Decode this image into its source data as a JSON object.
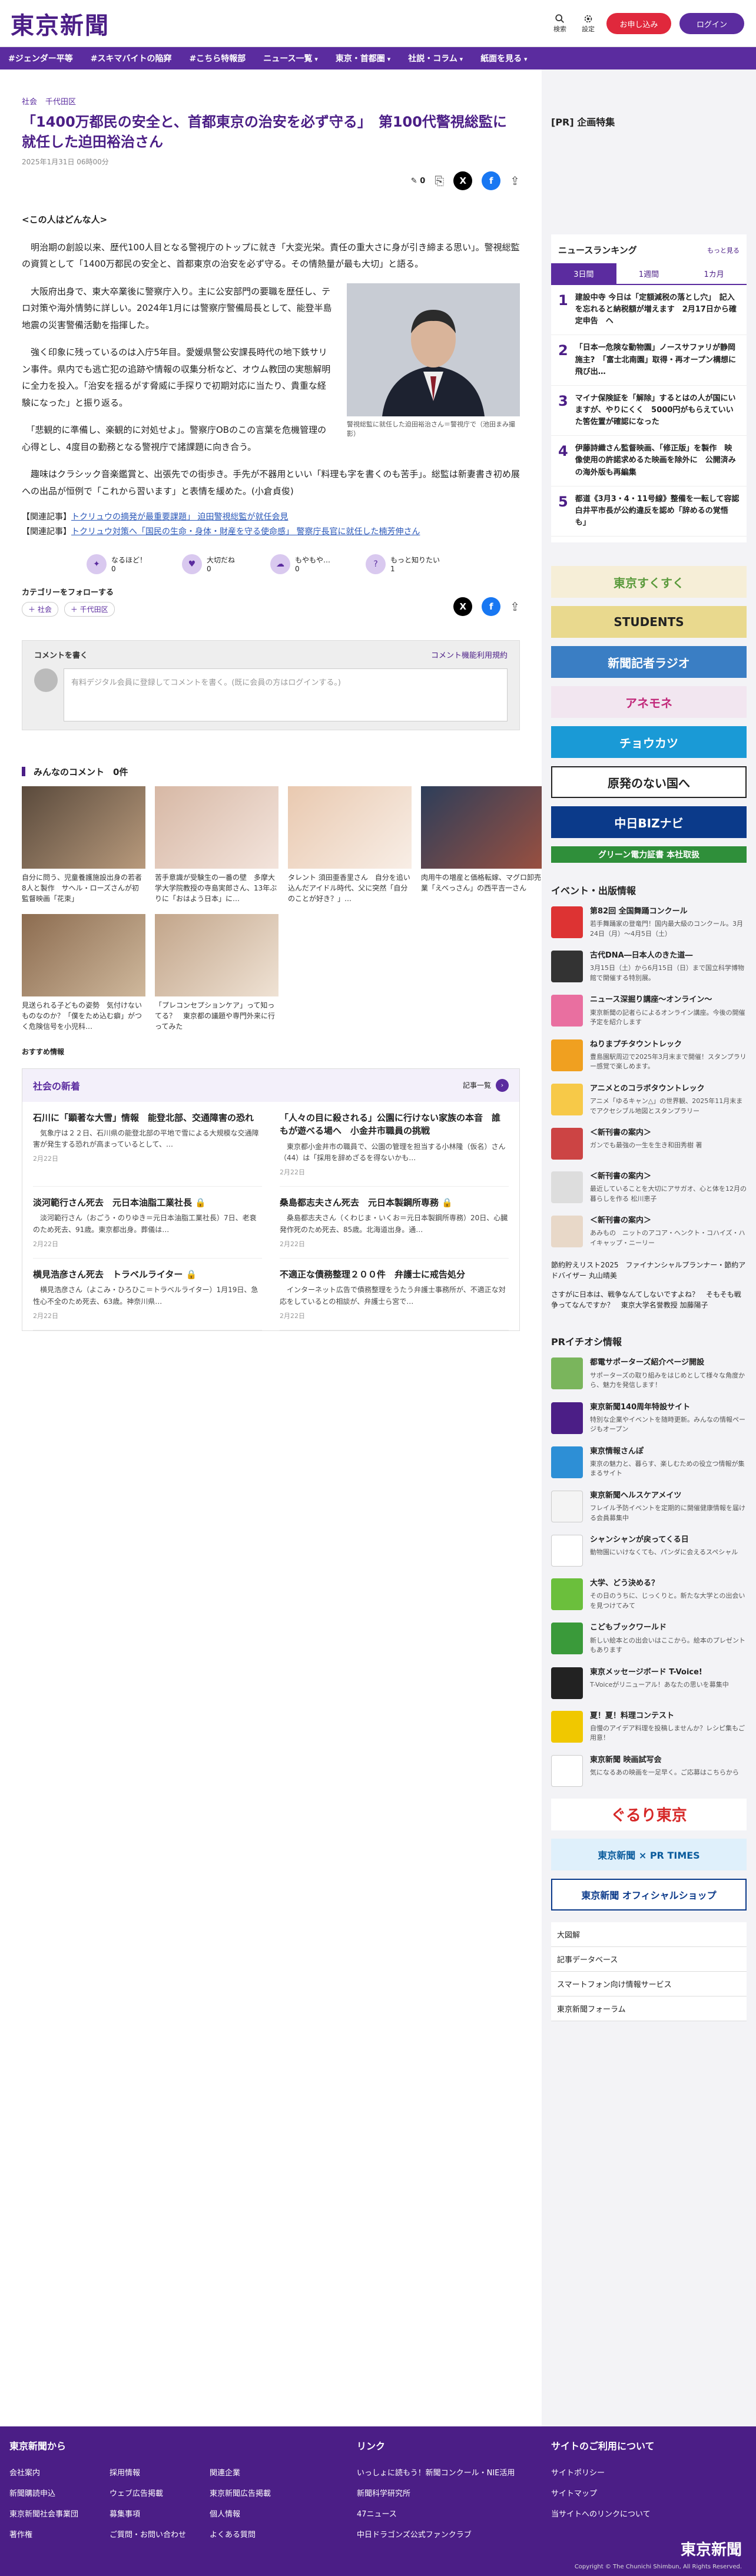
{
  "header": {
    "logo": "東京新聞",
    "search": "検索",
    "settings": "設定",
    "subscribe": "お申し込み",
    "login": "ログイン"
  },
  "nav": [
    "#ジェンダー平等",
    "#スキマバイトの陥穽",
    "#こちら特報部",
    "ニュース一覧",
    "東京・首都圏",
    "社説・コラム",
    "紙面を見る"
  ],
  "crumbs": [
    "社会",
    "千代田区"
  ],
  "article": {
    "title": "「1400万都民の安全と、首都東京の治安を必ず守る」　第100代警視総監に就任した迫田裕治さん",
    "date": "2025年1月31日 06時00分",
    "comment_count": "0",
    "paras": [
      "<この人はどんな人>",
      "　明治期の創設以来、歴代100人目となる警視庁のトップに就き「大変光栄。責任の重大さに身が引き締まる思い」。警視総監の資質として「1400万都民の安全と、首都東京の治安を必ず守る。その情熱量が最も大切」と語る。",
      "　大阪府出身で、東大卒業後に警察庁入り。主に公安部門の要職を歴任し、テロ対策や海外情勢に詳しい。2024年1月には警察庁警備局長として、能登半島地震の災害警備活動を指揮した。",
      "　強く印象に残っているのは入庁5年目。愛媛県警公安課長時代の地下鉄サリン事件。県内でも逃亡犯の追跡や情報の収集分析など、オウム教団の実態解明に全力を投入。「治安を揺るがす脅威に手探りで初期対応に当たり、貴重な経験になった」と振り返る。",
      "　「悲観的に準備し、楽観的に対処せよ」。警察庁OBのこの言葉を危機管理の心得とし、4度目の勤務となる警視庁で諸課題に向き合う。",
      "　趣味はクラシック音楽鑑賞と、出張先での街歩き。手先が不器用といい「料理も字を書くのも苦手」。総監は新妻書き初め展への出品が恒例で「これから習います」と表情を緩めた。(小倉貞俊)"
    ],
    "photo_caption": "警視総監に就任した迫田裕治さん＝警視庁で（池田まみ撮影）",
    "related": [
      {
        "label": "【関連記事】",
        "link": "トクリュウの摘発が最重要課題」 迫田警視総監が就任会見"
      },
      {
        "label": "【関連記事】",
        "link": "トクリュウ対策へ「国民の生命・身体・財産を守る使命感」 警察庁長官に就任した楠芳伸さん"
      }
    ],
    "reactions": [
      {
        "label": "なるほど！",
        "n": "0"
      },
      {
        "label": "大切だね",
        "n": "0"
      },
      {
        "label": "もやもや…",
        "n": "0"
      },
      {
        "label": "もっと知りたい",
        "n": "1"
      }
    ],
    "follow": "カテゴリーをフォローする",
    "tags": [
      "社会",
      "千代田区"
    ]
  },
  "comments": {
    "title": "コメントを書く",
    "rules": "コメント機能利用規約",
    "placeholder": "有料デジタル会員に登録してコメントを書く。(既に会員の方はログインする。)",
    "count_title": "みんなのコメント　0件"
  },
  "grid": [
    "自分に問う、児童養護施設出身の若者8人と製作　サヘル・ローズさんが初監督映画「花束」",
    "苦手意識が受験生の一番の壁　多摩大学大学院教授の寺島実郎さん、13年ぶりに「おはよう日本」に…",
    "タレント 須田亜香里さん　自分を追い込んだアイドル時代、父に突然「自分のことが好き？」…",
    "肉用牛の増産と価格転嫁、マグロ卸売業「えべっさん」の西平吉一さん",
    "見送られる子どもの姿勢　気付けないものなのか？「僕をため込む癖」がつく危険信号を小児科…",
    "「プレコンセプションケア」って知ってる？　東京都の議題や専門外来に行ってみた"
  ],
  "recommend": "おすすめ情報",
  "society": {
    "title": "社会の新着",
    "more": "記事一覧",
    "items": [
      {
        "t": "石川に「顕著な大雪」情報　能登北部、交通障害の恐れ",
        "d": "　気象庁は２２日、石川県の能登北部の平地で雪による大規模な交通障害が発生する恐れが高まっているとして、…",
        "dt": "2月22日"
      },
      {
        "t": "「人々の目に殺される」公園に行けない家族の本音　誰もが遊べる場へ　小金井市職員の挑戦",
        "d": "　東京都小金井市の職員で、公園の管理を担当する小林隆（仮名）さん（44）は「採用を辞めざるを得ないかも…",
        "dt": "2月22日"
      },
      {
        "t": "淡河範行さん死去　元日本油脂工業社長",
        "d": "　淡河範行さん（おごう・のりゆき＝元日本油脂工業社長）7日、老衰のため死去、91歳。東京都出身。葬儀は…",
        "dt": "2月22日"
      },
      {
        "t": "桑島都志夫さん死去　元日本製鋼所専務",
        "d": "　桑島都志夫さん（くわじま・いくお＝元日本製鋼所専務）20日、心臓発作死のため死去、85歳。北海道出身。通…",
        "dt": "2月22日"
      },
      {
        "t": "横見浩彦さん死去　トラベルライター",
        "d": "　横見浩彦さん（よこみ・ひろひこ＝トラベルライター）1月19日、急性心不全のため死去、63歳。神奈川県…",
        "dt": "2月22日"
      },
      {
        "t": "不適正な債務整理２００件　弁護士に戒告処分",
        "d": "　インターネット広告で債務整理をうたう弁護士事務所が、不適正な対応をしているとの相談が、弁護士ら宮で…",
        "dt": "2月22日"
      }
    ]
  },
  "side": {
    "pr": "[PR] 企画特集",
    "ranking_title": "ニュースランキング",
    "ranking_more": "もっと見る",
    "tabs": [
      "3日間",
      "1週間",
      "1カ月"
    ],
    "rank": [
      "建設中寺 今日は「定額減税の落とし穴」　記入を忘れると納税額が増えます　2月17日から確定申告　ヘ",
      "「日本一危険な動物園」ノースサファリが静岡施主?　「富士北南園」取得・再オープン構想に飛び出…",
      "マイナ保険証を「解除」するとはの人が国にいますが、やりにくく　5000円がもらえていいた筈佐置が確認になった",
      "伊藤詩織さん監督映画、「修正版」を製作　映像使用の許諾求めるた映画を除外に　公開済みの海外版も再編集",
      "都道《3月3・4・11号線》整備を一転して容認　白井平市長が公約違反を認め「辞めるの覚悟も」"
    ],
    "ads": [
      "東京すくすく",
      "STUDENTS",
      "新聞記者ラジオ",
      "アネモネ",
      "チョウカツ",
      "原発のない国へ",
      "中日BIZナビ",
      "グリーン電力証書 本社取扱"
    ],
    "events_title": "イベント・出版情報",
    "events": [
      {
        "t": "第82回 全国舞踊コンクール",
        "d": "若手舞踊家の登竜門！国内最大級のコンクール。3月24日（月）〜4月5日（土）"
      },
      {
        "t": "古代DNA―日本人のきた道―",
        "d": "3月15日（土）から6月15日（日）まで国立科学博物館で開催する特別展。"
      },
      {
        "t": "ニュース深掘り講座〜オンライン〜",
        "d": "東京新聞の記者らによるオンライン講座。今後の開催予定を紹介します"
      },
      {
        "t": "ねりまプチタウントレック",
        "d": "豊島園駅周辺で2025年3月末まで開催！スタンプラリー感覚で楽しめます。"
      },
      {
        "t": "アニメとのコラボタウントレック",
        "d": "アニメ「ゆるキャン△」の世界観、2025年11月末までアクセシブル地図とスタンプラリー"
      },
      {
        "t": "＜新刊書の案内＞",
        "d": "ガンでも最強の一生を生き和田秀樹 著"
      },
      {
        "t": "＜新刊書の案内＞",
        "d": "最近していることを大切にアサガオ、心と体を12月の暮らしを作る 松川恵子"
      },
      {
        "t": "＜新刊書の案内＞",
        "d": "あみもの　ニットのアコア・ヘンクト・コハイズ・ハイキャップ・ニーリー"
      }
    ],
    "etc1": "節約貯えリスト2025　ファイナンシャルプランナー・節約アドバイザー 丸山晴美",
    "etc2": "さすがに日本は、戦争なんてしないですよね？　そもそも戦争ってなんですか？　東京大学名誉教授 加藤陽子",
    "pr_title": "PRイチオシ情報",
    "pr_items": [
      {
        "t": "都電サポーターズ紹介ページ開設",
        "d": "サポーターズの取り組みをはじめとして様々な角度から、魅力を発信します！"
      },
      {
        "t": "東京新聞140周年特設サイト",
        "d": "特別な企業やイベントを随時更新。みんなの情報ページもオープン"
      },
      {
        "t": "東京情報さんぽ",
        "d": "東京の魅力と、暮らす、楽しむための役立つ情報が集まるサイト"
      },
      {
        "t": "東京新聞ヘルスケアメイツ",
        "d": "フレイル予防イベントを定期的に開催健康情報を届ける会員募集中"
      },
      {
        "t": "シャンシャンが戻ってくる日",
        "d": "動物園にいけなくても、パンダに会えるスペシャル"
      },
      {
        "t": "大学、どう決める？",
        "d": "その日のうちに、じっくりと。新たな大学との出会いを見つけてみて"
      },
      {
        "t": "こどもブックワールド",
        "d": "新しい絵本との出会いはここから。絵本のプレゼントもあります"
      },
      {
        "t": "東京メッセージボード T-Voice!",
        "d": "T-Voiceがリニューアル！あなたの思いを募集中"
      },
      {
        "t": "夏！夏！料理コンテスト",
        "d": "自慢のアイデア料理を投稿しませんか？レシピ集もご用意！"
      },
      {
        "t": "東京新聞 映画試写会",
        "d": "気になるあの映画を一足早く。ご応募はこちらから"
      }
    ],
    "banners": [
      "ぐるり東京",
      "東京新聞 × PR TIMES",
      "東京新聞 オフィシャルショップ"
    ],
    "links": [
      "大図解",
      "記事データベース",
      "スマートフォン向け情報サービス",
      "東京新聞フォーラム"
    ]
  },
  "footer": {
    "h1": "東京新聞から",
    "col1": [
      "会社案内",
      "新聞購読申込",
      "東京新聞社会事業団",
      "著作権"
    ],
    "col2": [
      "採用情報",
      "ウェブ広告掲載",
      "募集事項",
      "ご質問・お問い合わせ"
    ],
    "col3": [
      "関連企業",
      "東京新聞広告掲載",
      "個人情報",
      "よくある質問"
    ],
    "h2": "リンク",
    "col4": [
      "いっしょに読もう！新聞コンクール・NIE活用",
      "新聞科学研究所",
      "47ニュース",
      "中日ドラゴンズ公式ファンクラブ"
    ],
    "h3": "サイトのご利用について",
    "col5": [
      "サイトポリシー",
      "サイトマップ",
      "当サイトへのリンクについて"
    ],
    "logo": "東京新聞",
    "copy": "Copyright © The Chunichi Shimbun, All Rights Reserved."
  }
}
